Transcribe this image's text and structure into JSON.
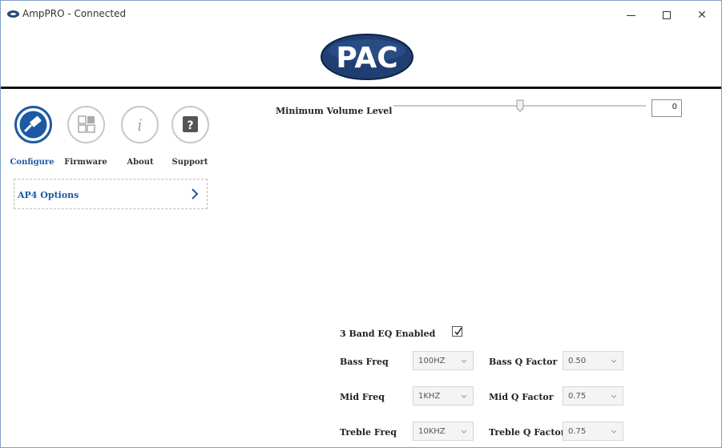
{
  "window": {
    "title": "AmpPRO - Connected",
    "controls": {
      "minimize": "minimize",
      "maximize": "maximize",
      "close": "✕"
    }
  },
  "header": {
    "logo_text": "PAC"
  },
  "nav": {
    "items": [
      {
        "label": "Configure",
        "icon": "usb-cable-icon",
        "active": true
      },
      {
        "label": "Firmware",
        "icon": "grid-icon",
        "active": false
      },
      {
        "label": "About",
        "icon": "info-icon",
        "active": false
      },
      {
        "label": "Support",
        "icon": "question-icon",
        "active": false
      }
    ]
  },
  "options": {
    "label": "AP4 Options",
    "chevron": "›"
  },
  "volume": {
    "label": "Minimum Volume Level",
    "value": "0",
    "slider_fraction": 0.46
  },
  "eq": {
    "enabled_label": "3 Band EQ Enabled",
    "enabled": true,
    "rows": [
      {
        "freq_label": "Bass Freq",
        "freq_value": "100HZ",
        "q_label": "Bass Q Factor",
        "q_value": "0.50"
      },
      {
        "freq_label": "Mid Freq",
        "freq_value": "1KHZ",
        "q_label": "Mid Q Factor",
        "q_value": "0.75"
      },
      {
        "freq_label": "Treble Freq",
        "freq_value": "10KHZ",
        "q_label": "Treble Q Factor",
        "q_value": "0.75"
      }
    ]
  },
  "colors": {
    "accent": "#1e5aa3",
    "logo_fill": "#1f3f73",
    "divider": "#111111"
  }
}
